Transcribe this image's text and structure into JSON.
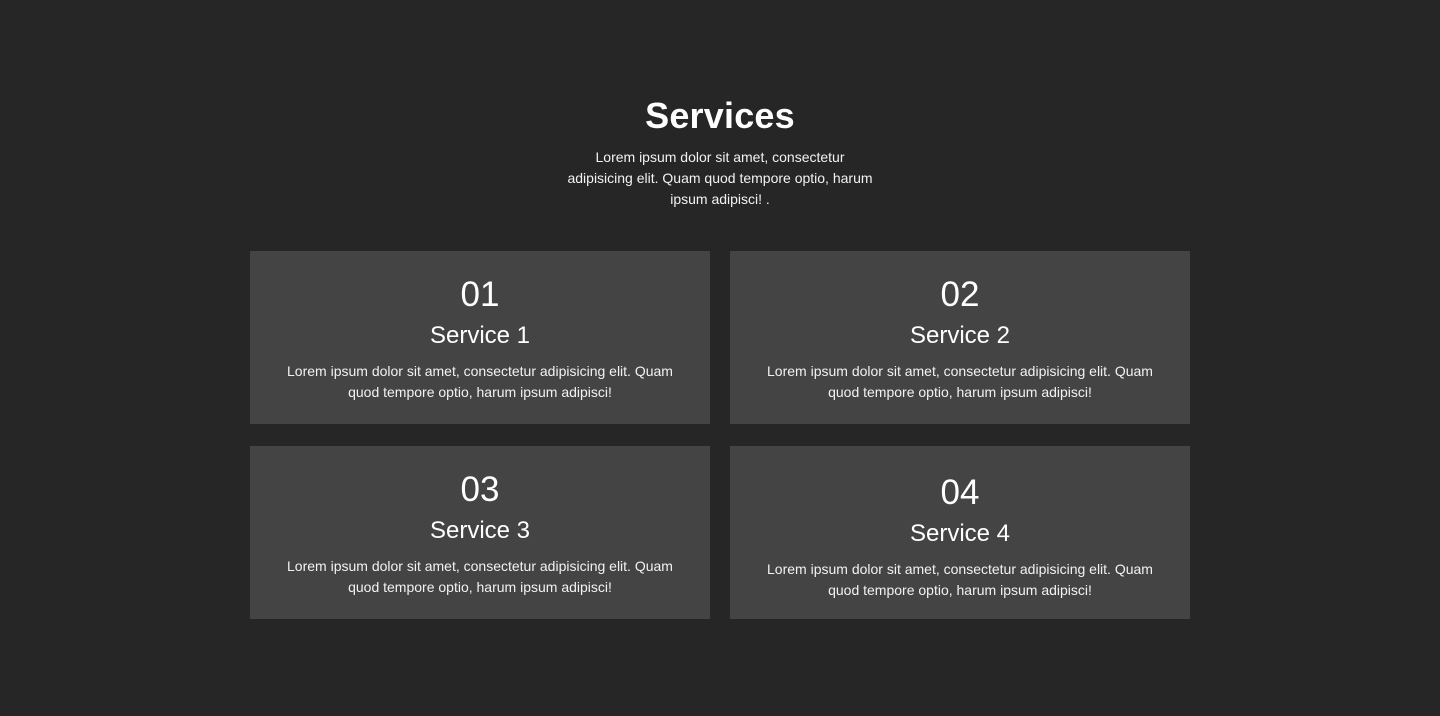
{
  "section": {
    "title": "Services",
    "intro": "Lorem ipsum dolor sit amet, consectetur adipisicing elit. Quam quod tempore optio, harum ipsum adipisci! ."
  },
  "services": [
    {
      "number": "01",
      "title": "Service 1",
      "description": "Lorem ipsum dolor sit amet, consectetur adipisicing elit. Quam quod tempore optio, harum ipsum adipisci!"
    },
    {
      "number": "02",
      "title": "Service 2",
      "description": "Lorem ipsum dolor sit amet, consectetur adipisicing elit. Quam quod tempore optio, harum ipsum adipisci!"
    },
    {
      "number": "03",
      "title": "Service 3",
      "description": "Lorem ipsum dolor sit amet, consectetur adipisicing elit. Quam quod tempore optio, harum ipsum adipisci!"
    },
    {
      "number": "04",
      "title": "Service 4",
      "description": "Lorem ipsum dolor sit amet, consectetur adipisicing elit. Quam quod tempore optio, harum ipsum adipisci!"
    }
  ],
  "colors": {
    "background": "#262626",
    "card": "#444444",
    "text": "#ffffff"
  }
}
